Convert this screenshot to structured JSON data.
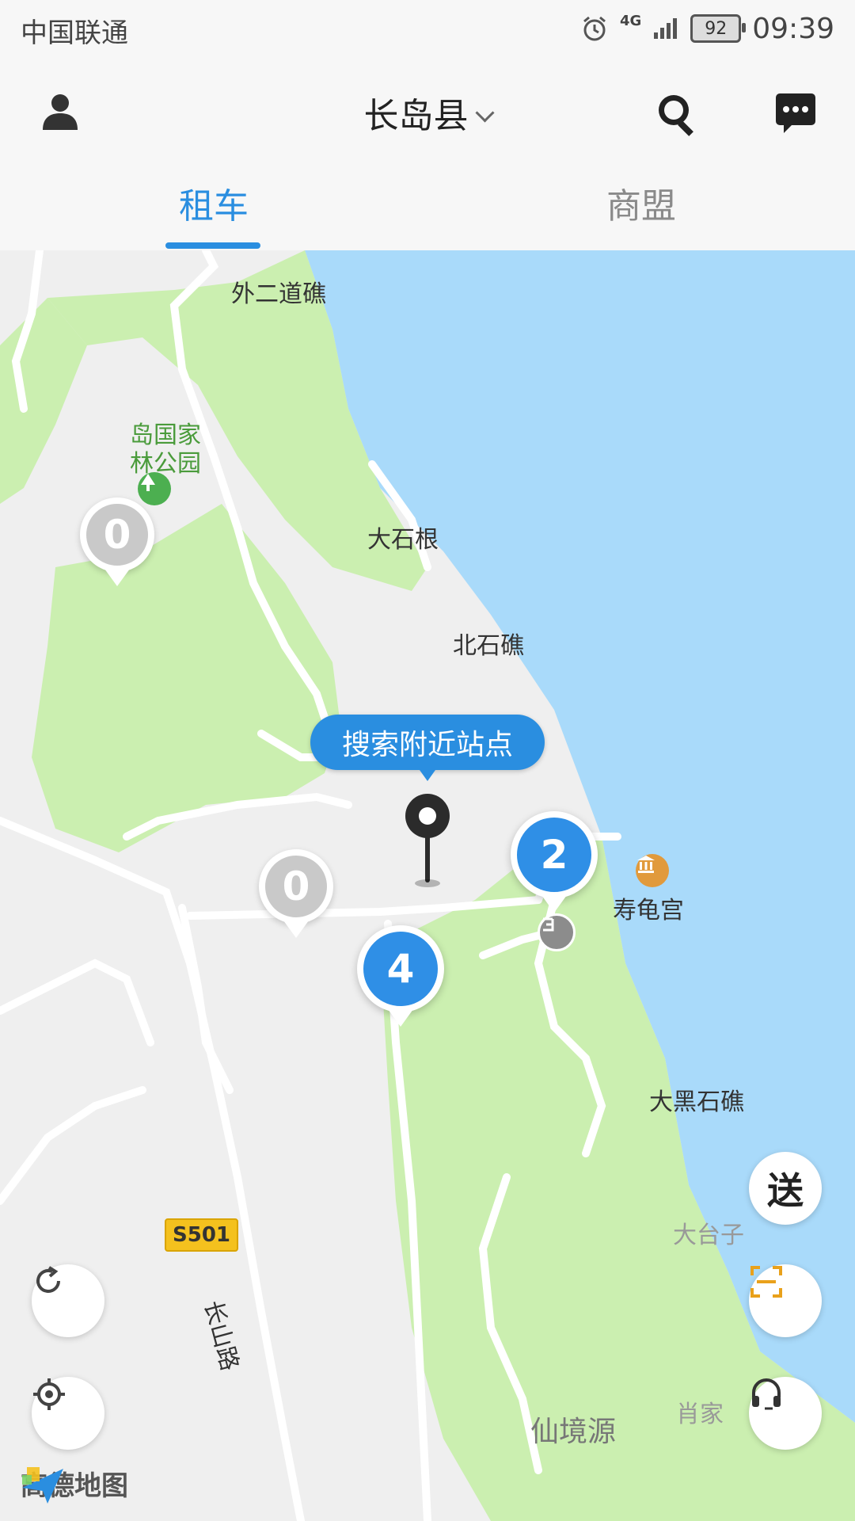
{
  "status_bar": {
    "carrier": "中国联通",
    "network": "4G",
    "battery": "92",
    "time": "09:39"
  },
  "header": {
    "title": "长岛县",
    "icons": {
      "profile": "person-icon",
      "search": "search-icon",
      "message": "chat-icon"
    }
  },
  "tabs": [
    {
      "label": "租车",
      "active": true
    },
    {
      "label": "商盟",
      "active": false
    }
  ],
  "map": {
    "callout": "搜索附近站点",
    "places": {
      "p1": "外二道礁",
      "p2": "岛国家",
      "p3": "林公园",
      "p4": "大石根",
      "p5": "北石礁",
      "p6": "寿龟宫",
      "p7": "大黑石礁",
      "p8": "大台子",
      "p9": "长山路",
      "p10": "仙境源",
      "p11": "肖家"
    },
    "road_badge": "S501",
    "markers": {
      "m1": "0",
      "m2": "0",
      "m3": "2",
      "m4": "4"
    },
    "attribution": "高德地图"
  },
  "fabs": {
    "deliver": "送",
    "scan": "scan-icon",
    "refresh": "refresh-icon",
    "locate": "locate-icon",
    "support": "headset-icon"
  },
  "colors": {
    "accent": "#2a8ee0",
    "water": "#a9dafa",
    "park": "#cbefb0"
  }
}
